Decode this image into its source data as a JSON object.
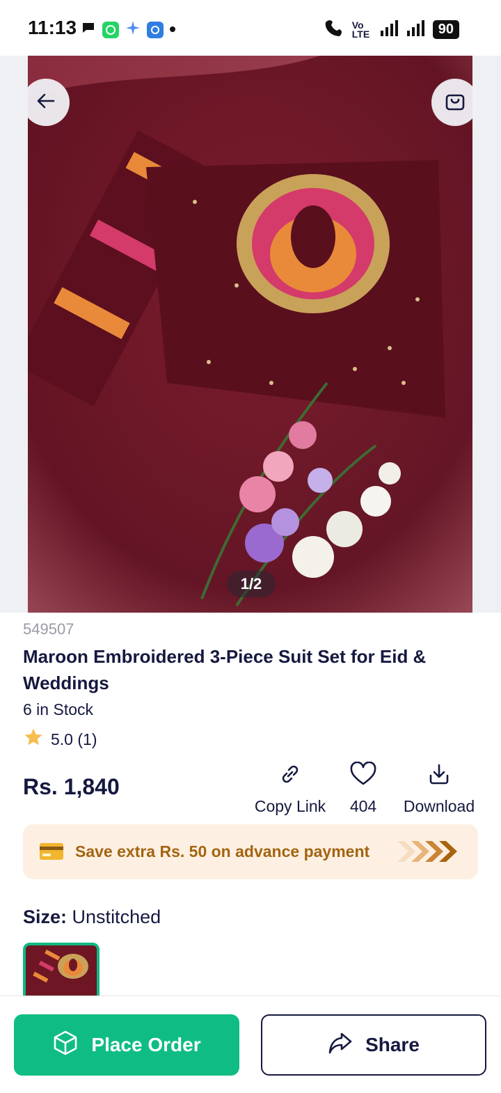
{
  "status_bar": {
    "time": "11:13",
    "network": "Vo LTE",
    "battery": "90"
  },
  "hero": {
    "image_counter": "1/2",
    "icons": {
      "back": "arrow-left-icon",
      "cart": "shopping-bag-icon"
    }
  },
  "product": {
    "id": "549507",
    "title": "Maroon Embroidered 3-Piece Suit Set for Eid & Weddings",
    "stock": "6 in Stock",
    "rating": "5.0 (1)",
    "price": "Rs. 1,840"
  },
  "actions": {
    "copy_link": "Copy Link",
    "likes": "404",
    "download": "Download"
  },
  "promo": {
    "text": "Save extra Rs. 50 on advance payment"
  },
  "size": {
    "label": "Size:",
    "value": "Unstitched"
  },
  "bottom_bar": {
    "place_order": "Place Order",
    "share": "Share"
  },
  "colors": {
    "brand_green": "#0fbd84",
    "text_navy": "#15193f",
    "promo_bg": "#fdf0e3",
    "promo_text": "#a36410",
    "fabric_maroon": "#6e1624"
  }
}
